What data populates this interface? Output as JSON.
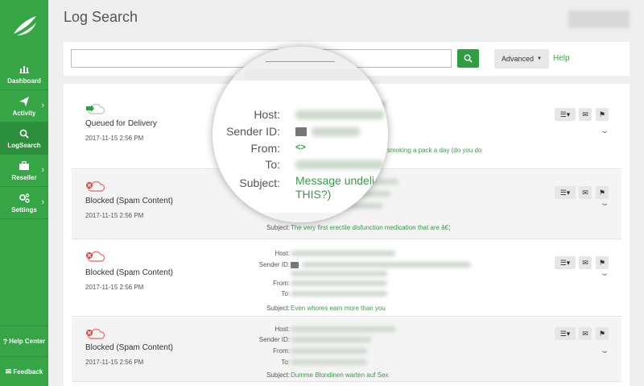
{
  "nav": {
    "items": [
      {
        "label": "Dashboard",
        "icon": "bar-chart-icon"
      },
      {
        "label": "Activity",
        "icon": "paper-plane-icon"
      },
      {
        "label": "LogSearch",
        "icon": "search-icon"
      },
      {
        "label": "Reseller",
        "icon": "briefcase-icon"
      },
      {
        "label": "Settings",
        "icon": "gears-icon"
      }
    ],
    "help_center": "Help Center",
    "feedback": "Feedback"
  },
  "header": {
    "title": "Log Search"
  },
  "search": {
    "value": "",
    "advanced_label": "Advanced",
    "help_label": "Help"
  },
  "labels": {
    "host": "Host:",
    "sender_id": "Sender ID:",
    "from": "From:",
    "to": "To:",
    "subject": "Subject:"
  },
  "results": [
    {
      "status": "Queued for Delivery",
      "status_type": "queued",
      "timestamp": "2017-11-15 2:56 PM",
      "subject": "smoking a pack a day (do you do"
    },
    {
      "status": "Blocked (Spam Content)",
      "status_type": "blocked",
      "timestamp": "2017-11-15 2:56 PM",
      "subject": "The very first erectile disfunction medication that are â€¦"
    },
    {
      "status": "Blocked (Spam Content)",
      "status_type": "blocked",
      "timestamp": "2017-11-15 2:56 PM",
      "subject": "Even whores earn more than you"
    },
    {
      "status": "Blocked (Spam Content)",
      "status_type": "blocked",
      "timestamp": "2017-11-15 2:56 PM",
      "subject": "Dumme Blondinen warten auf Sex"
    }
  ],
  "magnifier": {
    "host": "Host:",
    "sender_id": "Sender ID:",
    "from": "From:",
    "to": "To:",
    "subject": "Subject:",
    "from_value": "<>",
    "subject_line1": "Message undeli",
    "subject_line2": "THIS?)"
  },
  "colors": {
    "brand": "#35a546",
    "subject_text": "#3a9a48",
    "blocked": "#e0443a",
    "queued": "#2f9e43"
  }
}
